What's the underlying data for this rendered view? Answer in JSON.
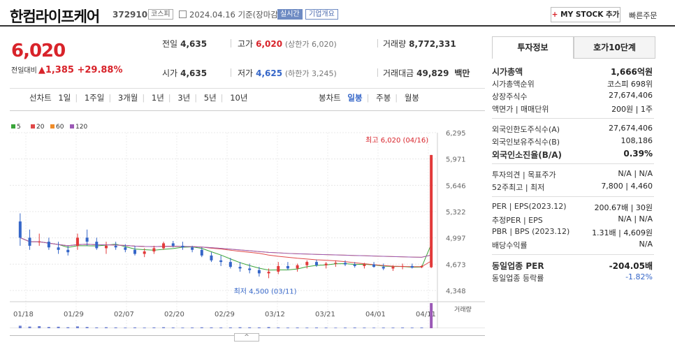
{
  "header": {
    "name": "한컴라이프케어",
    "code": "372910",
    "market": "코스피",
    "date": "2024.04.16 기준(장마감)",
    "realtime": "실시간",
    "corp": "기업개요",
    "mystock": "MY STOCK 추가",
    "mystock_plus": "+",
    "quick": "빠른주문"
  },
  "quote": {
    "price": "6,020",
    "change_label": "전일대비",
    "change": "1,385",
    "rate": "+29.88%",
    "prev_label": "전일",
    "prev": "4,635",
    "high_label": "고가",
    "high": "6,020",
    "high_sub": "(상한가 6,020)",
    "vol_label": "거래량",
    "vol": "8,772,331",
    "open_label": "시가",
    "open": "4,635",
    "low_label": "저가",
    "low": "4,625",
    "low_sub": "(하한가 3,245)",
    "amt_label": "거래대금",
    "amt": "49,829",
    "amt_unit": "백만"
  },
  "chart_tabs": {
    "line_label": "선차트",
    "periods": [
      "1일",
      "1주일",
      "3개월",
      "1년",
      "3년",
      "5년",
      "10년"
    ],
    "candle_label": "봉차트",
    "candles": [
      "일봉",
      "주봉",
      "월봉"
    ]
  },
  "legend": [
    {
      "label": "5",
      "color": "#3aa53a"
    },
    {
      "label": "20",
      "color": "#e04848"
    },
    {
      "label": "60",
      "color": "#f08c28"
    },
    {
      "label": "120",
      "color": "#9b59b6"
    }
  ],
  "chart_data": {
    "type": "candlestick",
    "y_ticks": [
      "6,295",
      "5,971",
      "5,646",
      "5,322",
      "4,997",
      "4,673",
      "4,348"
    ],
    "x_ticks": [
      "01/18",
      "01/29",
      "02/07",
      "02/20",
      "02/29",
      "03/12",
      "03/21",
      "04/01",
      "04/11"
    ],
    "high_note": "최고 6,020 (04/16)",
    "low_note": "최저 4,500 (03/11)",
    "volume_label": "거래량",
    "ohlc": [
      [
        5200,
        5300,
        4900,
        5000
      ],
      [
        5000,
        5100,
        4850,
        4900
      ],
      [
        4950,
        5050,
        4900,
        4950
      ],
      [
        4950,
        5000,
        4850,
        4880
      ],
      [
        4880,
        4950,
        4800,
        4850
      ],
      [
        4850,
        4900,
        4780,
        4820
      ],
      [
        4900,
        5050,
        4850,
        5000
      ],
      [
        5000,
        5100,
        4900,
        4950
      ],
      [
        4950,
        5000,
        4850,
        4870
      ],
      [
        4870,
        4950,
        4800,
        4900
      ],
      [
        4900,
        4950,
        4850,
        4880
      ],
      [
        4880,
        4920,
        4820,
        4850
      ],
      [
        4850,
        4900,
        4780,
        4800
      ],
      [
        4800,
        4870,
        4760,
        4830
      ],
      [
        4830,
        4900,
        4800,
        4870
      ],
      [
        4870,
        4950,
        4850,
        4930
      ],
      [
        4930,
        4960,
        4880,
        4900
      ],
      [
        4900,
        4950,
        4850,
        4880
      ],
      [
        4880,
        4900,
        4820,
        4850
      ],
      [
        4850,
        4880,
        4760,
        4780
      ],
      [
        4780,
        4820,
        4700,
        4720
      ],
      [
        4720,
        4780,
        4650,
        4700
      ],
      [
        4700,
        4750,
        4620,
        4640
      ],
      [
        4640,
        4700,
        4580,
        4620
      ],
      [
        4620,
        4680,
        4560,
        4600
      ],
      [
        4600,
        4640,
        4520,
        4560
      ],
      [
        4560,
        4620,
        4500,
        4580
      ],
      [
        4580,
        4700,
        4550,
        4650
      ],
      [
        4650,
        4700,
        4600,
        4620
      ],
      [
        4620,
        4680,
        4580,
        4660
      ],
      [
        4660,
        4720,
        4620,
        4700
      ],
      [
        4700,
        4730,
        4640,
        4660
      ],
      [
        4660,
        4700,
        4620,
        4680
      ],
      [
        4680,
        4720,
        4640,
        4690
      ],
      [
        4690,
        4720,
        4650,
        4670
      ],
      [
        4670,
        4700,
        4630,
        4650
      ],
      [
        4650,
        4690,
        4620,
        4670
      ],
      [
        4670,
        4700,
        4630,
        4640
      ],
      [
        4640,
        4680,
        4600,
        4620
      ],
      [
        4620,
        4660,
        4590,
        4640
      ],
      [
        4640,
        4680,
        4610,
        4650
      ],
      [
        4650,
        4680,
        4620,
        4630
      ],
      [
        4635,
        4660,
        4625,
        4650
      ],
      [
        4635,
        6020,
        4625,
        6020
      ]
    ],
    "volume": [
      30,
      20,
      25,
      15,
      18,
      12,
      22,
      15,
      10,
      12,
      10,
      8,
      10,
      8,
      10,
      12,
      9,
      8,
      9,
      11,
      10,
      9,
      10,
      12,
      11,
      10,
      14,
      10,
      8,
      9,
      8,
      9,
      8,
      7,
      8,
      9,
      8,
      7,
      8,
      8,
      9,
      8,
      9,
      300
    ]
  },
  "right": {
    "tab_active": "투자정보",
    "tab_other": "호가10단계",
    "rows1": [
      {
        "k": "시가총액",
        "v": "1,666억원",
        "bold": true
      },
      {
        "k": "시가총액순위",
        "v": "코스피 698위"
      },
      {
        "k": "상장주식수",
        "v": "27,674,406"
      },
      {
        "k": "액면가 | 매매단위",
        "v": "200원 | 1주"
      }
    ],
    "rows2": [
      {
        "k": "외국인한도주식수(A)",
        "v": "27,674,406"
      },
      {
        "k": "외국인보유주식수(B)",
        "v": "108,186"
      },
      {
        "k": "외국인소진율(B/A)",
        "v": "0.39%",
        "bold": true
      }
    ],
    "rows3": [
      {
        "k": "투자의견 | 목표주가",
        "v": "N/A | N/A"
      },
      {
        "k": "52주최고 | 최저",
        "v": "7,800 | 4,460"
      }
    ],
    "rows4": [
      {
        "k": "PER | EPS(2023.12)",
        "v": "200.67배 | 30원"
      },
      {
        "k": "추정PER | EPS",
        "v": "N/A | N/A"
      },
      {
        "k": "PBR | BPS (2023.12)",
        "v": "1.31배 | 4,609원"
      },
      {
        "k": "배당수익률",
        "v": "N/A"
      }
    ],
    "rows5": [
      {
        "k": "동일업종 PER",
        "v": "-204.05배",
        "bold": true
      },
      {
        "k": "동일업종 등락률",
        "v": "-1.82%",
        "blue": true
      }
    ]
  },
  "handle": "^"
}
